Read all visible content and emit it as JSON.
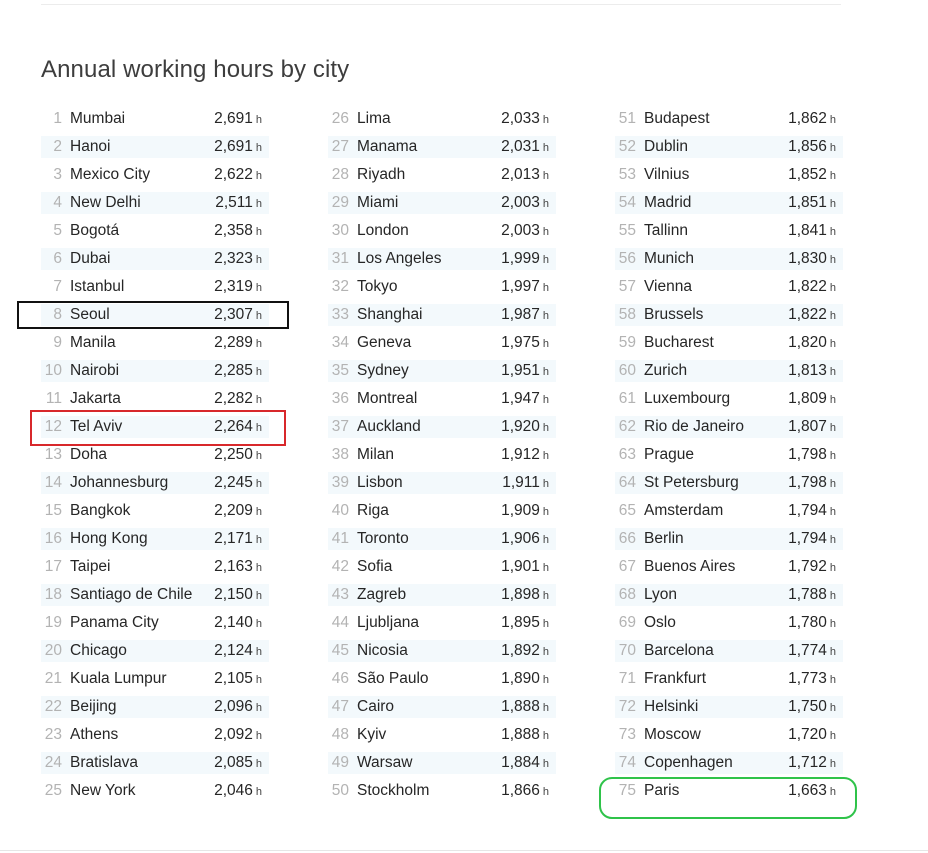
{
  "title": "Annual working hours by city",
  "unit": "h",
  "columns": [
    [
      {
        "rank": "1",
        "city": "Mumbai",
        "hours": "2,691"
      },
      {
        "rank": "2",
        "city": "Hanoi",
        "hours": "2,691"
      },
      {
        "rank": "3",
        "city": "Mexico City",
        "hours": "2,622"
      },
      {
        "rank": "4",
        "city": "New Delhi",
        "hours": "2,511"
      },
      {
        "rank": "5",
        "city": "Bogotá",
        "hours": "2,358"
      },
      {
        "rank": "6",
        "city": "Dubai",
        "hours": "2,323"
      },
      {
        "rank": "7",
        "city": "Istanbul",
        "hours": "2,319"
      },
      {
        "rank": "8",
        "city": "Seoul",
        "hours": "2,307"
      },
      {
        "rank": "9",
        "city": "Manila",
        "hours": "2,289"
      },
      {
        "rank": "10",
        "city": "Nairobi",
        "hours": "2,285"
      },
      {
        "rank": "11",
        "city": "Jakarta",
        "hours": "2,282"
      },
      {
        "rank": "12",
        "city": "Tel Aviv",
        "hours": "2,264"
      },
      {
        "rank": "13",
        "city": "Doha",
        "hours": "2,250"
      },
      {
        "rank": "14",
        "city": "Johannesburg",
        "hours": "2,245"
      },
      {
        "rank": "15",
        "city": "Bangkok",
        "hours": "2,209"
      },
      {
        "rank": "16",
        "city": "Hong Kong",
        "hours": "2,171"
      },
      {
        "rank": "17",
        "city": "Taipei",
        "hours": "2,163"
      },
      {
        "rank": "18",
        "city": "Santiago de Chile",
        "hours": "2,150"
      },
      {
        "rank": "19",
        "city": "Panama City",
        "hours": "2,140"
      },
      {
        "rank": "20",
        "city": "Chicago",
        "hours": "2,124"
      },
      {
        "rank": "21",
        "city": "Kuala Lumpur",
        "hours": "2,105"
      },
      {
        "rank": "22",
        "city": "Beijing",
        "hours": "2,096"
      },
      {
        "rank": "23",
        "city": "Athens",
        "hours": "2,092"
      },
      {
        "rank": "24",
        "city": "Bratislava",
        "hours": "2,085"
      },
      {
        "rank": "25",
        "city": "New York",
        "hours": "2,046"
      }
    ],
    [
      {
        "rank": "26",
        "city": "Lima",
        "hours": "2,033"
      },
      {
        "rank": "27",
        "city": "Manama",
        "hours": "2,031"
      },
      {
        "rank": "28",
        "city": "Riyadh",
        "hours": "2,013"
      },
      {
        "rank": "29",
        "city": "Miami",
        "hours": "2,003"
      },
      {
        "rank": "30",
        "city": "London",
        "hours": "2,003"
      },
      {
        "rank": "31",
        "city": "Los Angeles",
        "hours": "1,999"
      },
      {
        "rank": "32",
        "city": "Tokyo",
        "hours": "1,997"
      },
      {
        "rank": "33",
        "city": "Shanghai",
        "hours": "1,987"
      },
      {
        "rank": "34",
        "city": "Geneva",
        "hours": "1,975"
      },
      {
        "rank": "35",
        "city": "Sydney",
        "hours": "1,951"
      },
      {
        "rank": "36",
        "city": "Montreal",
        "hours": "1,947"
      },
      {
        "rank": "37",
        "city": "Auckland",
        "hours": "1,920"
      },
      {
        "rank": "38",
        "city": "Milan",
        "hours": "1,912"
      },
      {
        "rank": "39",
        "city": "Lisbon",
        "hours": "1,911"
      },
      {
        "rank": "40",
        "city": "Riga",
        "hours": "1,909"
      },
      {
        "rank": "41",
        "city": "Toronto",
        "hours": "1,906"
      },
      {
        "rank": "42",
        "city": "Sofia",
        "hours": "1,901"
      },
      {
        "rank": "43",
        "city": "Zagreb",
        "hours": "1,898"
      },
      {
        "rank": "44",
        "city": "Ljubljana",
        "hours": "1,895"
      },
      {
        "rank": "45",
        "city": "Nicosia",
        "hours": "1,892"
      },
      {
        "rank": "46",
        "city": "São Paulo",
        "hours": "1,890"
      },
      {
        "rank": "47",
        "city": "Cairo",
        "hours": "1,888"
      },
      {
        "rank": "48",
        "city": "Kyiv",
        "hours": "1,888"
      },
      {
        "rank": "49",
        "city": "Warsaw",
        "hours": "1,884"
      },
      {
        "rank": "50",
        "city": "Stockholm",
        "hours": "1,866"
      }
    ],
    [
      {
        "rank": "51",
        "city": "Budapest",
        "hours": "1,862"
      },
      {
        "rank": "52",
        "city": "Dublin",
        "hours": "1,856"
      },
      {
        "rank": "53",
        "city": "Vilnius",
        "hours": "1,852"
      },
      {
        "rank": "54",
        "city": "Madrid",
        "hours": "1,851"
      },
      {
        "rank": "55",
        "city": "Tallinn",
        "hours": "1,841"
      },
      {
        "rank": "56",
        "city": "Munich",
        "hours": "1,830"
      },
      {
        "rank": "57",
        "city": "Vienna",
        "hours": "1,822"
      },
      {
        "rank": "58",
        "city": "Brussels",
        "hours": "1,822"
      },
      {
        "rank": "59",
        "city": "Bucharest",
        "hours": "1,820"
      },
      {
        "rank": "60",
        "city": "Zurich",
        "hours": "1,813"
      },
      {
        "rank": "61",
        "city": "Luxembourg",
        "hours": "1,809"
      },
      {
        "rank": "62",
        "city": "Rio de Janeiro",
        "hours": "1,807"
      },
      {
        "rank": "63",
        "city": "Prague",
        "hours": "1,798"
      },
      {
        "rank": "64",
        "city": "St Petersburg",
        "hours": "1,798"
      },
      {
        "rank": "65",
        "city": "Amsterdam",
        "hours": "1,794"
      },
      {
        "rank": "66",
        "city": "Berlin",
        "hours": "1,794"
      },
      {
        "rank": "67",
        "city": "Buenos Aires",
        "hours": "1,792"
      },
      {
        "rank": "68",
        "city": "Lyon",
        "hours": "1,788"
      },
      {
        "rank": "69",
        "city": "Oslo",
        "hours": "1,780"
      },
      {
        "rank": "70",
        "city": "Barcelona",
        "hours": "1,774"
      },
      {
        "rank": "71",
        "city": "Frankfurt",
        "hours": "1,773"
      },
      {
        "rank": "72",
        "city": "Helsinki",
        "hours": "1,750"
      },
      {
        "rank": "73",
        "city": "Moscow",
        "hours": "1,720"
      },
      {
        "rank": "74",
        "city": "Copenhagen",
        "hours": "1,712"
      },
      {
        "rank": "75",
        "city": "Paris",
        "hours": "1,663"
      }
    ]
  ],
  "highlights": [
    {
      "city": "Seoul",
      "color": "#111111"
    },
    {
      "city": "Tel Aviv",
      "color": "#d8282b"
    },
    {
      "city": "Paris",
      "color": "#2fc34a"
    }
  ]
}
